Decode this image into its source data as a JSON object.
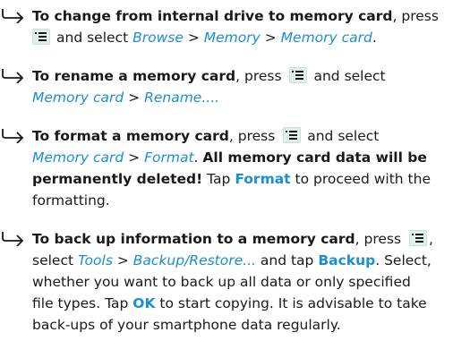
{
  "items": [
    {
      "title": "To change from internal drive to memory card",
      "press": ", press",
      "and_select": "and select",
      "path": [
        "Browse",
        "Memory",
        "Memory card"
      ],
      "sep": ">",
      "end": "."
    },
    {
      "title": "To rename a memory card",
      "press": ", press",
      "and_select": "and select",
      "path": [
        "Memory card",
        "Rename...."
      ],
      "sep": ">"
    },
    {
      "title": "To format a memory card",
      "press": ", press",
      "and_select": "and select",
      "path": [
        "Memory card",
        "Format"
      ],
      "sep": ">",
      "end": ".",
      "warning_line1": "All memory card data will be",
      "warning_line2": "permanently deleted!",
      "tap": "Tap",
      "format_button": "Format",
      "proceed": "to proceed with the",
      "tail": "formatting."
    },
    {
      "title": "To back up information to a memory card",
      "press": ", press",
      "comma": ",",
      "select": "select",
      "path": [
        "Tools",
        "Backup/Restore..."
      ],
      "sep": ">",
      "and_tap": "and tap",
      "backup_button": "Backup",
      "after_backup": ". Select,",
      "line3": "whether you want to back up all data or only specified",
      "line4_a": "file types. Tap",
      "ok_button": "OK",
      "line4_b": "to start copying. It is advisable to take",
      "line5": "back-ups of your smartphone data regularly."
    }
  ],
  "icons": {
    "arrow": "right-hook-arrow-icon",
    "menu_key": "menu-key-icon"
  },
  "colors": {
    "link": "#1a8fd6",
    "menu_key_bg": "#dff0ea",
    "text": "#1a1a1a"
  }
}
